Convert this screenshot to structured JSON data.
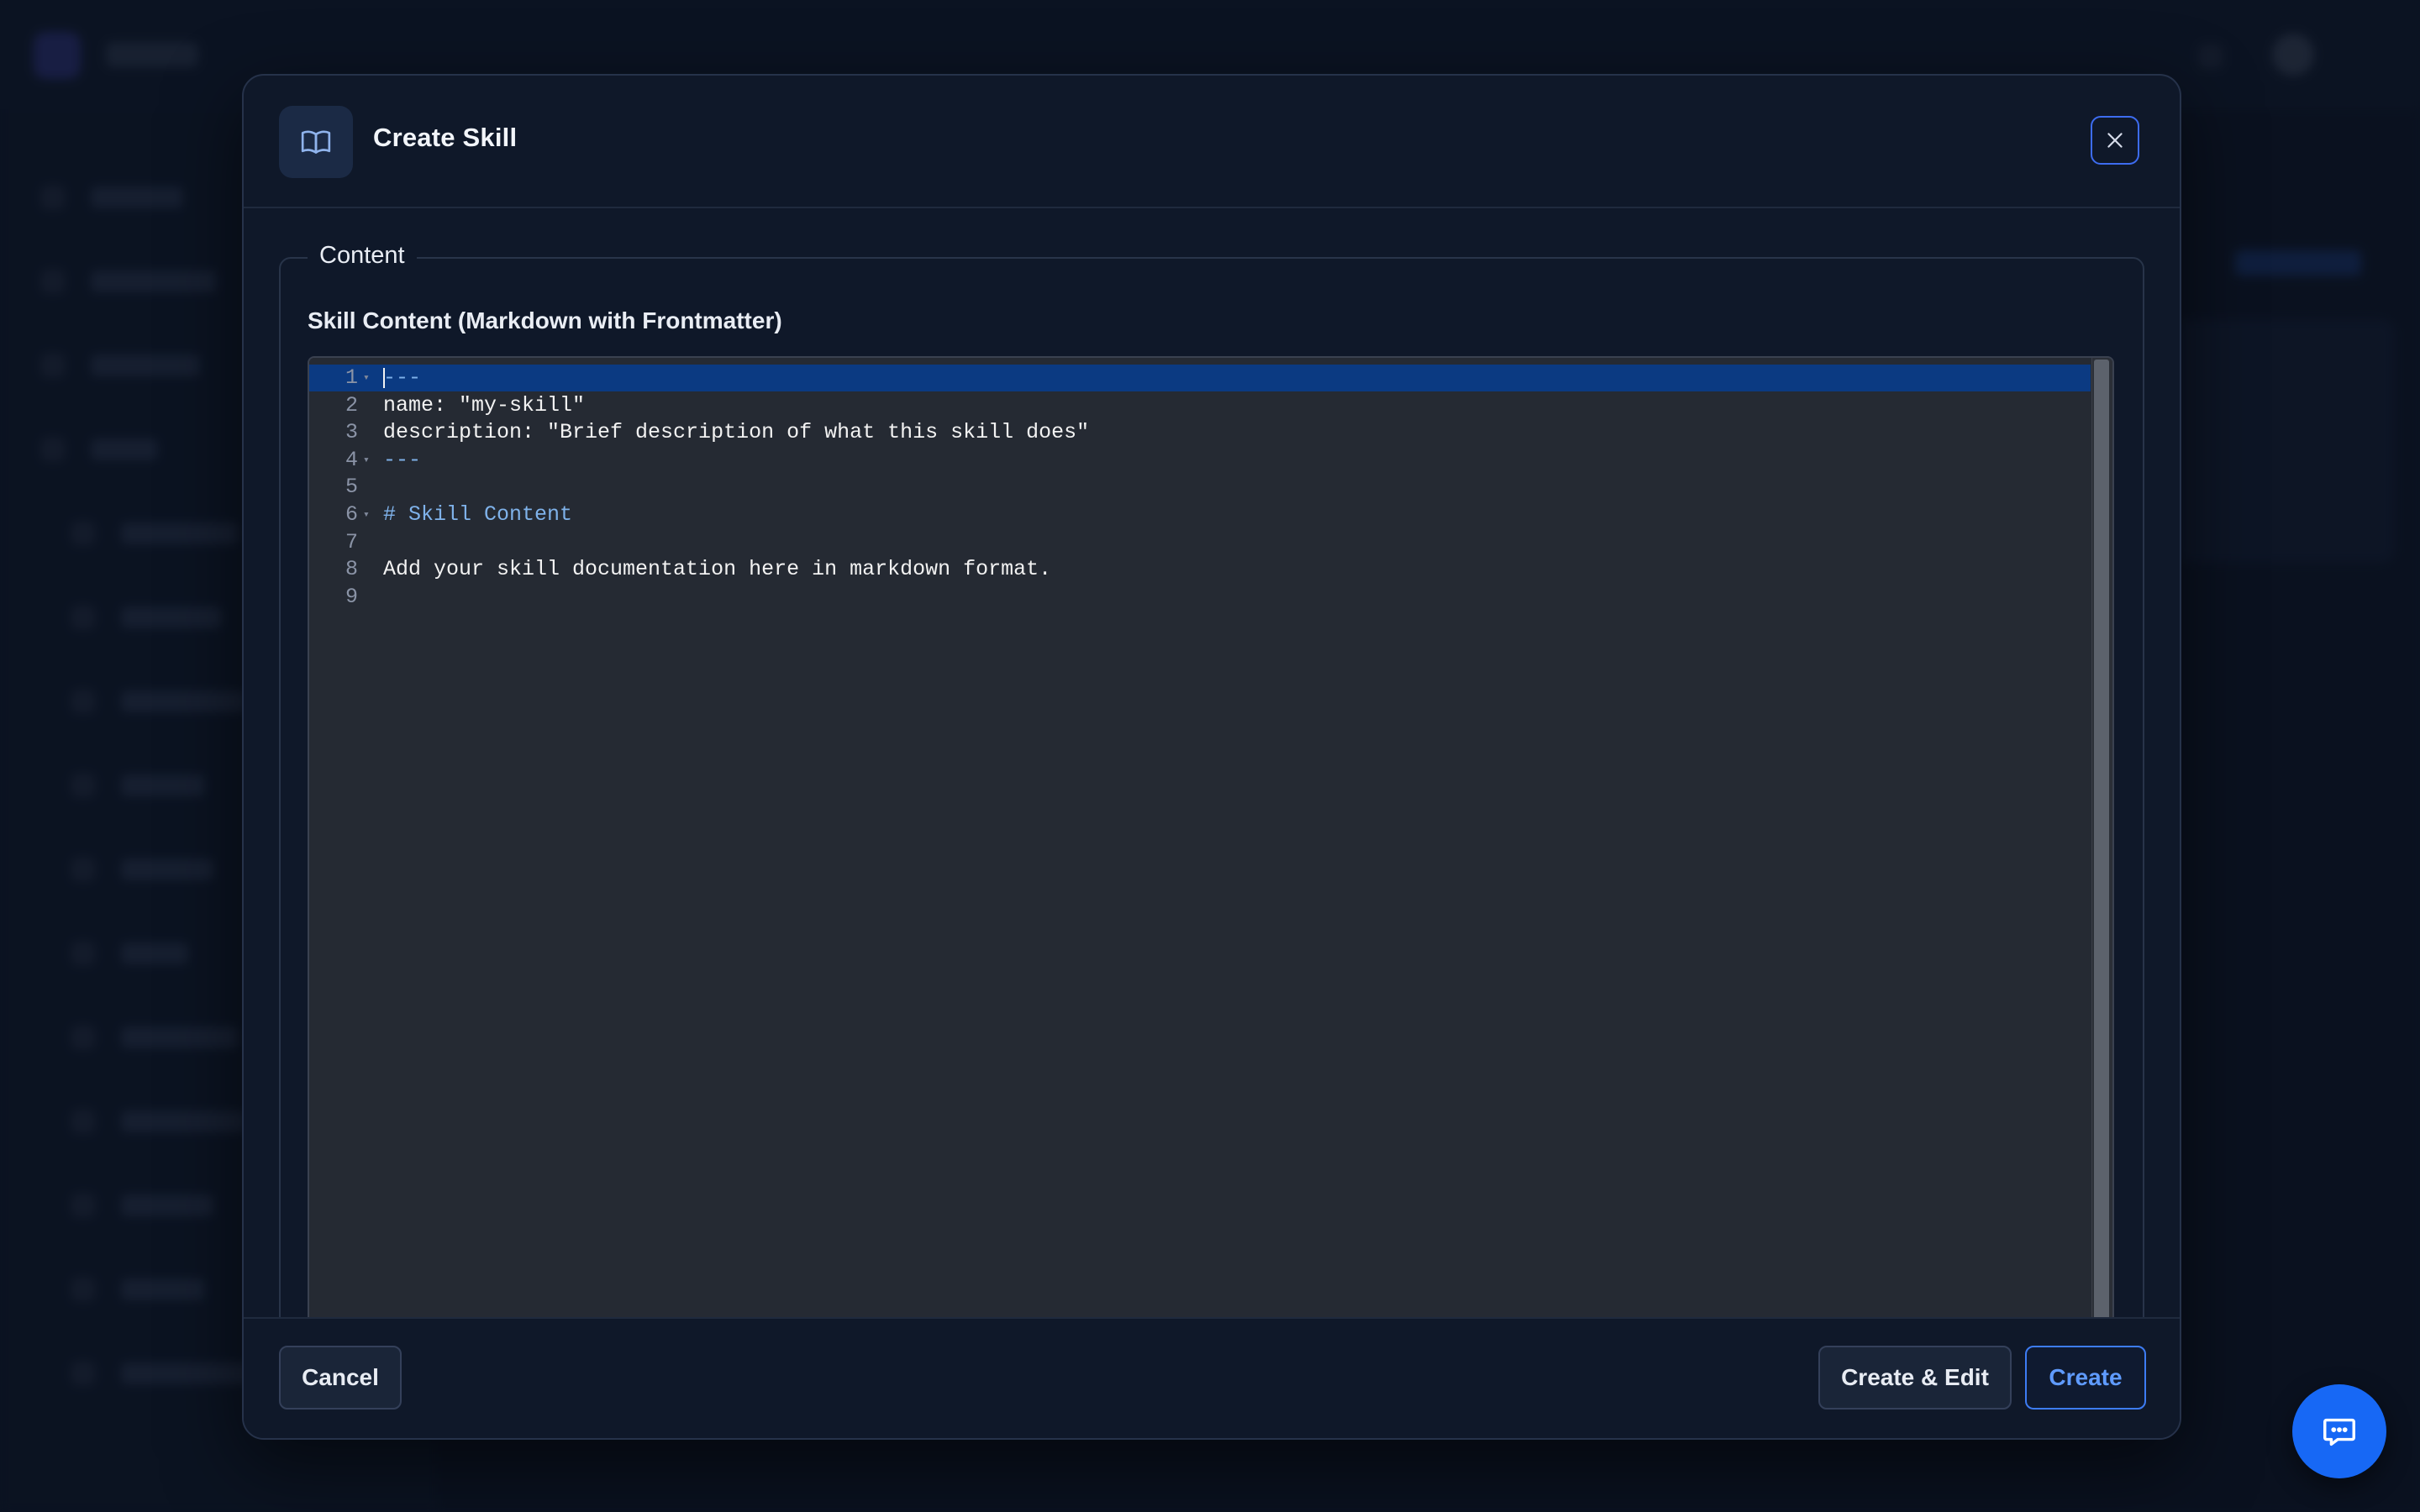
{
  "modal": {
    "title": "Create Skill",
    "header_icon": "book-open-icon",
    "close_icon": "close-icon"
  },
  "content_section": {
    "legend": "Content",
    "field_label": "Skill Content (Markdown with Frontmatter)"
  },
  "editor": {
    "lines": [
      {
        "number": "1",
        "text": "---",
        "fold": true,
        "style": "dash",
        "active": true
      },
      {
        "number": "2",
        "text": "name: \"my-skill\"",
        "fold": false,
        "style": "plain",
        "active": false
      },
      {
        "number": "3",
        "text": "description: \"Brief description of what this skill does\"",
        "fold": false,
        "style": "plain",
        "active": false
      },
      {
        "number": "4",
        "text": "---",
        "fold": true,
        "style": "dash",
        "active": false
      },
      {
        "number": "5",
        "text": "",
        "fold": false,
        "style": "plain",
        "active": false
      },
      {
        "number": "6",
        "text": "# Skill Content",
        "fold": true,
        "style": "heading",
        "active": false
      },
      {
        "number": "7",
        "text": "",
        "fold": false,
        "style": "plain",
        "active": false
      },
      {
        "number": "8",
        "text": "Add your skill documentation here in markdown format.",
        "fold": false,
        "style": "plain",
        "active": false
      },
      {
        "number": "9",
        "text": "",
        "fold": false,
        "style": "plain",
        "active": false
      }
    ]
  },
  "footer": {
    "cancel_label": "Cancel",
    "create_edit_label": "Create & Edit",
    "create_label": "Create"
  },
  "chat_button": {
    "icon": "chat-bubble-icon"
  },
  "colors": {
    "accent": "#3d7cf3",
    "fab": "#1768f5",
    "modal_bg": "#0f1829",
    "editor_bg": "#252a33",
    "active_line": "#0b3a82"
  }
}
